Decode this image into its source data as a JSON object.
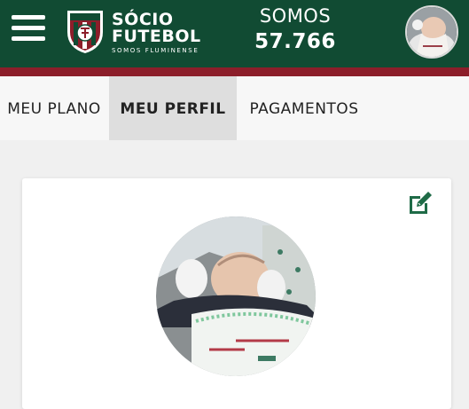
{
  "header": {
    "brand_line1": "SÓCIO",
    "brand_line2": "FUTEBOL",
    "brand_line3": "SOMOS FLUMINENSE",
    "somos_label": "SOMOS",
    "somos_count": "57.766",
    "colors": {
      "primary": "#114b33",
      "accent": "#8c1e2a"
    }
  },
  "tabs": [
    {
      "label": "MEU PLANO",
      "active": false
    },
    {
      "label": "MEU PERFIL",
      "active": true
    },
    {
      "label": "PAGAMENTOS",
      "active": false
    }
  ],
  "profile": {
    "edit_icon": "edit-icon",
    "photo_description": "baby-profile-photo"
  }
}
